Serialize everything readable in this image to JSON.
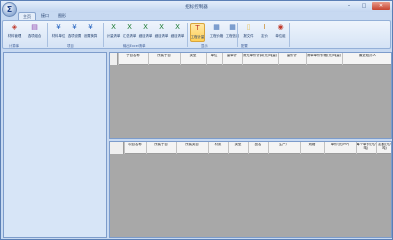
{
  "window": {
    "title": "招标控制器",
    "orb_glyph": "Σ",
    "minimize": "–",
    "maximize": "□",
    "close": "✕"
  },
  "tabs": [
    {
      "label": "主页",
      "active": true
    },
    {
      "label": "接口"
    },
    {
      "label": "图形"
    }
  ],
  "ribbon": {
    "buttons": [
      {
        "label": "材料管理",
        "icon": "materials-icon",
        "glyph": "◈",
        "color": "#c0392b"
      },
      {
        "label": "选项组合",
        "icon": "options-combine-icon",
        "glyph": "▤",
        "color": "#8e44ad"
      },
      {
        "label": "材料单位",
        "icon": "yen-icon",
        "glyph": "¥",
        "color": "#1f5fbf"
      },
      {
        "label": "选项设置",
        "icon": "yen-settings-icon",
        "glyph": "¥",
        "color": "#1f5fbf"
      },
      {
        "label": "设置换算",
        "icon": "yen-convert-icon",
        "glyph": "¥",
        "color": "#1f5fbf"
      },
      {
        "label": "计量清单",
        "icon": "excel-icon",
        "glyph": "X",
        "color": "#1e7b34"
      },
      {
        "label": "汇总清单",
        "icon": "excel-icon",
        "glyph": "X",
        "color": "#1e7b34"
      },
      {
        "label": "细目清单",
        "icon": "excel-icon",
        "glyph": "X",
        "color": "#1e7b34"
      },
      {
        "label": "细目清单",
        "icon": "excel-icon",
        "glyph": "X",
        "color": "#1e7b34"
      },
      {
        "label": "细目清单",
        "icon": "excel-icon",
        "glyph": "X",
        "color": "#1e7b34"
      },
      {
        "label": "工程计量",
        "icon": "engineering-measure-icon",
        "glyph": "T",
        "color": "#c0392b"
      },
      {
        "label": "工程价格",
        "icon": "price-icon",
        "glyph": "▦",
        "color": "#3f6fb5"
      },
      {
        "label": "工程信息",
        "icon": "info-icon",
        "glyph": "▦",
        "color": "#3f6fb5"
      },
      {
        "label": "报文件",
        "icon": "file-icon",
        "glyph": "▯",
        "color": "#e6c35a"
      },
      {
        "label": "定价",
        "icon": "pricing-icon",
        "glyph": "I",
        "color": "#c98b2a"
      },
      {
        "label": "单位组",
        "icon": "unit-group-icon",
        "glyph": "◉",
        "color": "#c0392b"
      }
    ],
    "groups": [
      "计算库",
      "项目",
      "输出Excel清单",
      "显示",
      "配置"
    ]
  },
  "top_grid": {
    "columns": [
      "子目名称",
      "所属子目",
      "类型",
      "单位",
      "量单计",
      "清无单价计算(元/吨量)",
      "量价计",
      "清单单价价格(元/吨量)",
      "最近经办人"
    ]
  },
  "bottom_grid": {
    "columns": [
      "项目名称",
      "所属子目",
      "所属类目",
      "材质",
      "类型",
      "品名",
      "生产厂",
      "规格",
      "单价(元/m³)",
      "每个单价(元/吨)",
      "定额(元/吨)"
    ]
  }
}
